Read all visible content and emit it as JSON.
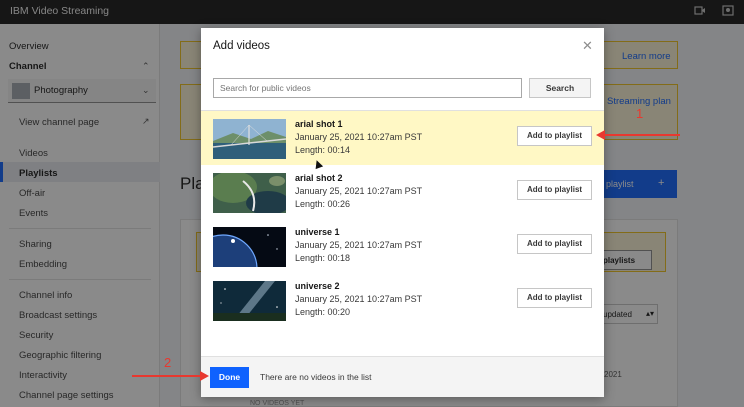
{
  "app": {
    "brand": "IBM Video Streaming"
  },
  "sidebar": {
    "overview": "Overview",
    "channel_head": "Channel",
    "channel_name": "Photography",
    "view_channel_page": "View channel page",
    "items_a": [
      "Videos",
      "Playlists",
      "Off-air",
      "Events"
    ],
    "items_b": [
      "Sharing",
      "Embedding"
    ],
    "items_c": [
      "Channel info",
      "Broadcast settings",
      "Security",
      "Geographic filtering",
      "Interactivity",
      "Channel page settings"
    ],
    "active": "Playlists"
  },
  "background": {
    "learn_more": "Learn more",
    "streaming_plan": "Streaming plan",
    "page_title_fragment": "Pla",
    "create_playlist_fragment": "playlist",
    "playlists_fragment": "playlists",
    "sort_fragment": "updated",
    "year_fragment": "2021",
    "no_videos_fragment": "NO VIDEOS YET"
  },
  "modal": {
    "title": "Add videos",
    "search_placeholder": "Search for public videos",
    "search_button": "Search",
    "videos": [
      {
        "title": "arial shot 1",
        "date": "January 25, 2021 10:27am PST",
        "length": "Length: 00:14",
        "action": "Add to playlist",
        "highlighted": true
      },
      {
        "title": "arial shot 2",
        "date": "January 25, 2021 10:27am PST",
        "length": "Length: 00:26",
        "action": "Add to playlist",
        "highlighted": false
      },
      {
        "title": "universe 1",
        "date": "January 25, 2021 10:27am PST",
        "length": "Length: 00:18",
        "action": "Add to playlist",
        "highlighted": false
      },
      {
        "title": "universe 2",
        "date": "January 25, 2021 10:27am PST",
        "length": "Length: 00:20",
        "action": "Add to playlist",
        "highlighted": false
      }
    ],
    "done_button": "Done",
    "footer_status": "There are no videos in the list"
  },
  "annotations": {
    "step1": "1",
    "step2": "2"
  },
  "colors": {
    "accent": "#0f62fe",
    "highlight": "#fff8c5",
    "annotation": "#e8382f",
    "topbar": "#161616"
  }
}
